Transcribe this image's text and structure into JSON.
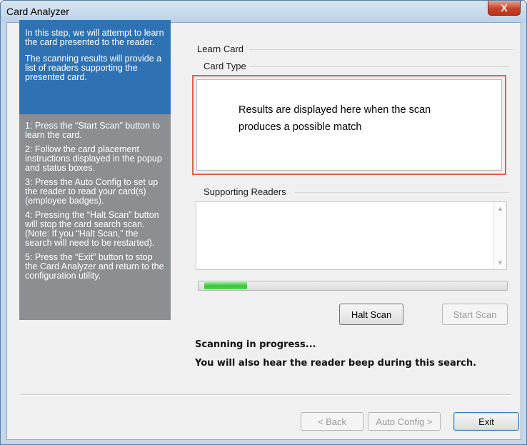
{
  "window": {
    "title": "Card Analyzer",
    "close_glyph": "X"
  },
  "sidebar": {
    "intro": [
      "In this step, we will attempt to learn the card presented to the reader.",
      "The scanning results will provide a list of readers supporting the presented card."
    ],
    "steps": [
      "1: Press the “Start Scan” button to learn the card.",
      "2: Follow the card placement instructions displayed in the popup and status boxes.",
      "3: Press the Auto Config to set up the reader to read your card(s) (employee badges).",
      "4: Pressing the “Halt Scan” button will stop the card search scan. (Note: If you “Halt Scan,” the search will need to be restarted).",
      "5: Press the “Exit” button to stop the Card Analyzer and return to the configuration utility."
    ]
  },
  "main": {
    "group_title": "Learn Card",
    "card_type_label": "Card Type",
    "card_type_result": "Results are displayed here when the scan produces a possible match",
    "supporting_readers_label": "Supporting Readers",
    "progress_fraction": 0.14,
    "halt_scan_label": "Halt Scan",
    "start_scan_label": "Start Scan",
    "status_line1": "Scanning in progress...",
    "status_line2": "You will also hear the reader beep during this search."
  },
  "footer": {
    "back_label": "< Back",
    "auto_config_label": "Auto Config >",
    "exit_label": "Exit"
  },
  "colors": {
    "sidebar_intro_bg": "#2e72b3",
    "sidebar_bg": "#8c8f92",
    "highlight_border": "#e0604f",
    "progress_green": "#37c337"
  }
}
